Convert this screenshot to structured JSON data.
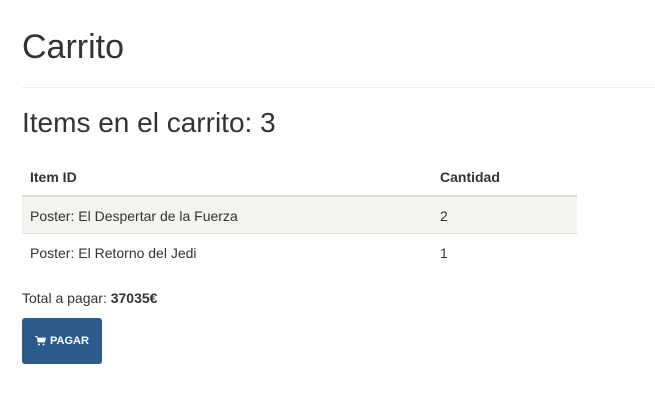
{
  "page": {
    "title": "Carrito",
    "items_heading": "Items en el carrito: 3"
  },
  "table": {
    "headers": [
      "Item ID",
      "Cantidad"
    ],
    "rows": [
      {
        "item": "Poster: El Despertar de la Fuerza",
        "qty": "2"
      },
      {
        "item": "Poster: El Retorno del Jedi",
        "qty": "1"
      }
    ]
  },
  "total": {
    "label": "Total a pagar:",
    "amount": "37035€"
  },
  "pay_button": {
    "label": "PAGAR",
    "icon": "shopping-cart-icon"
  },
  "colors": {
    "button_bg": "#2c5a8a",
    "stripe_row": "#f5f3ee"
  }
}
